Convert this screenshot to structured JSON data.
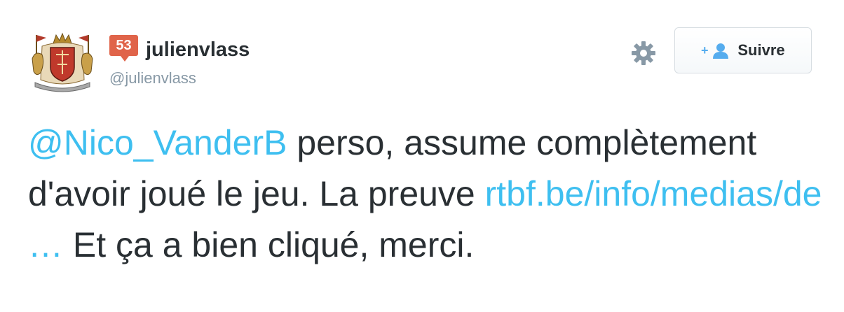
{
  "user": {
    "badge_count": "53",
    "display_name": "julienvlass",
    "handle": "@julienvlass",
    "avatar_icon": "coat-of-arms-avatar"
  },
  "actions": {
    "gear_icon": "gear-icon",
    "follow_icon": "add-user-icon",
    "follow_label": "Suivre"
  },
  "tweet": {
    "mention": "@Nico_VanderB",
    "text_before_link": " perso, assume complètement d'avoir joué le jeu. La preuve ",
    "link": "rtbf.be/info/medias/de …",
    "text_after_link": " Et ça a bien cliqué, merci."
  },
  "colors": {
    "link": "#3ebff0",
    "text": "#292f33",
    "muted": "#8899a6",
    "badge": "#e0644a",
    "accent": "#55acee"
  }
}
